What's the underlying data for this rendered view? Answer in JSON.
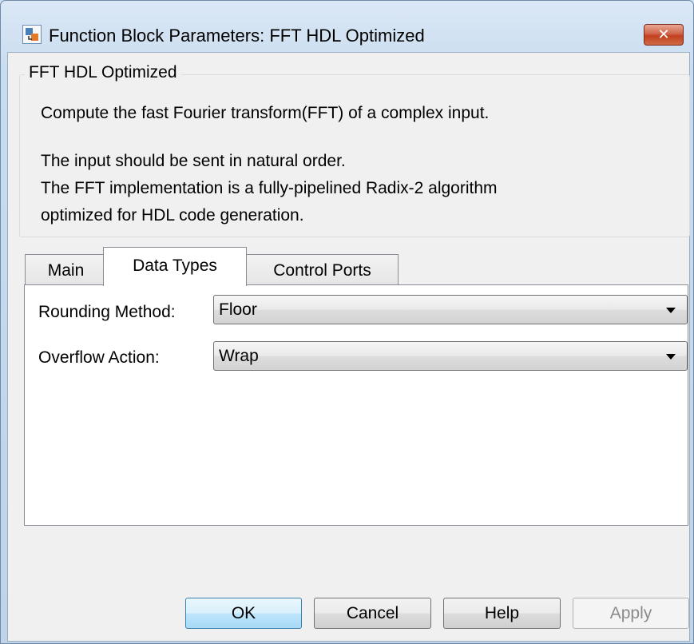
{
  "window": {
    "title": "Function Block Parameters: FFT HDL Optimized",
    "close_label": "✕"
  },
  "group": {
    "legend": "FFT HDL Optimized",
    "description": [
      "Compute the fast Fourier transform(FFT) of a complex input.",
      "The input should be sent in natural order.",
      "The FFT implementation is a fully-pipelined Radix-2 algorithm",
      "optimized for HDL code generation."
    ]
  },
  "tabs": [
    {
      "label": "Main",
      "active": false
    },
    {
      "label": "Data Types",
      "active": true
    },
    {
      "label": "Control Ports",
      "active": false
    }
  ],
  "fields": {
    "rounding": {
      "label": "Rounding Method:",
      "value": "Floor"
    },
    "overflow": {
      "label": "Overflow Action:",
      "value": "Wrap"
    }
  },
  "buttons": {
    "ok": "OK",
    "cancel": "Cancel",
    "help": "Help",
    "apply": "Apply"
  },
  "icons": {
    "title": "simulink-block-icon",
    "close": "close-icon",
    "dropdown": "chevron-down-icon"
  }
}
